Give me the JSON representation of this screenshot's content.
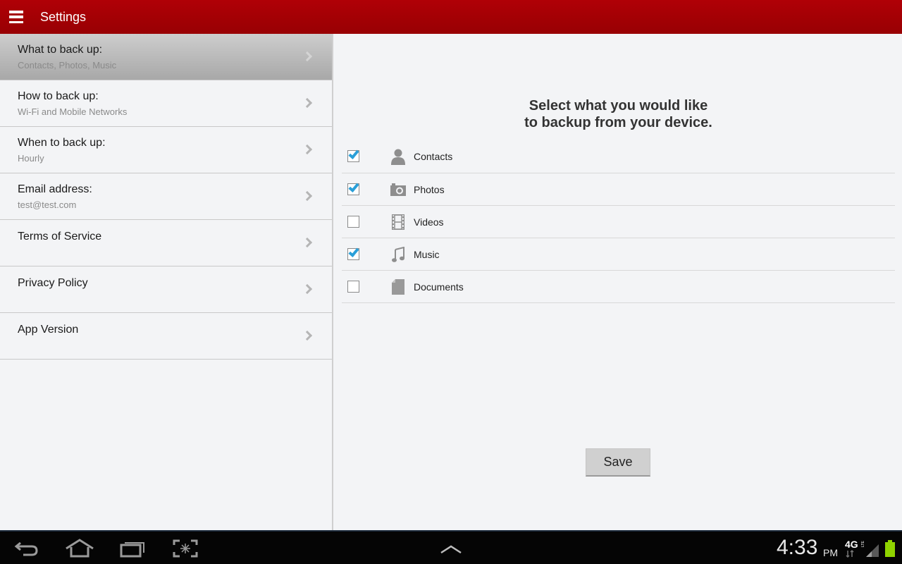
{
  "actionbar": {
    "title": "Settings",
    "menu_icon": "hamburger-menu-icon",
    "color": "#a80004"
  },
  "sidebar": {
    "items": [
      {
        "title": "What to back up:",
        "subtitle": "Contacts, Photos, Music",
        "active": true
      },
      {
        "title": "How to back up:",
        "subtitle": "Wi-Fi and Mobile Networks",
        "active": false
      },
      {
        "title": "When to back up:",
        "subtitle": "Hourly",
        "active": false
      },
      {
        "title": "Email address:",
        "subtitle": "test@test.com",
        "active": false
      },
      {
        "title": "Terms of Service",
        "subtitle": "",
        "active": false
      },
      {
        "title": "Privacy Policy",
        "subtitle": "",
        "active": false
      },
      {
        "title": "App Version",
        "subtitle": "",
        "active": false
      }
    ]
  },
  "content": {
    "heading_line1": "Select what you would like",
    "heading_line2": "to backup from your device.",
    "options": [
      {
        "label": "Contacts",
        "icon": "person-icon",
        "checked": true
      },
      {
        "label": "Photos",
        "icon": "camera-icon",
        "checked": true
      },
      {
        "label": "Videos",
        "icon": "film-icon",
        "checked": false
      },
      {
        "label": "Music",
        "icon": "music-note-icon",
        "checked": true
      },
      {
        "label": "Documents",
        "icon": "document-icon",
        "checked": false
      }
    ],
    "save_label": "Save",
    "check_color": "#2a9fd8"
  },
  "system_bar": {
    "buttons": [
      "back-icon",
      "home-icon",
      "recent-apps-icon",
      "screenshot-icon"
    ],
    "center": "chevron-up-icon",
    "time": "4:33",
    "ampm": "PM",
    "network": "4G LTE",
    "battery_color": "#8fd300"
  }
}
